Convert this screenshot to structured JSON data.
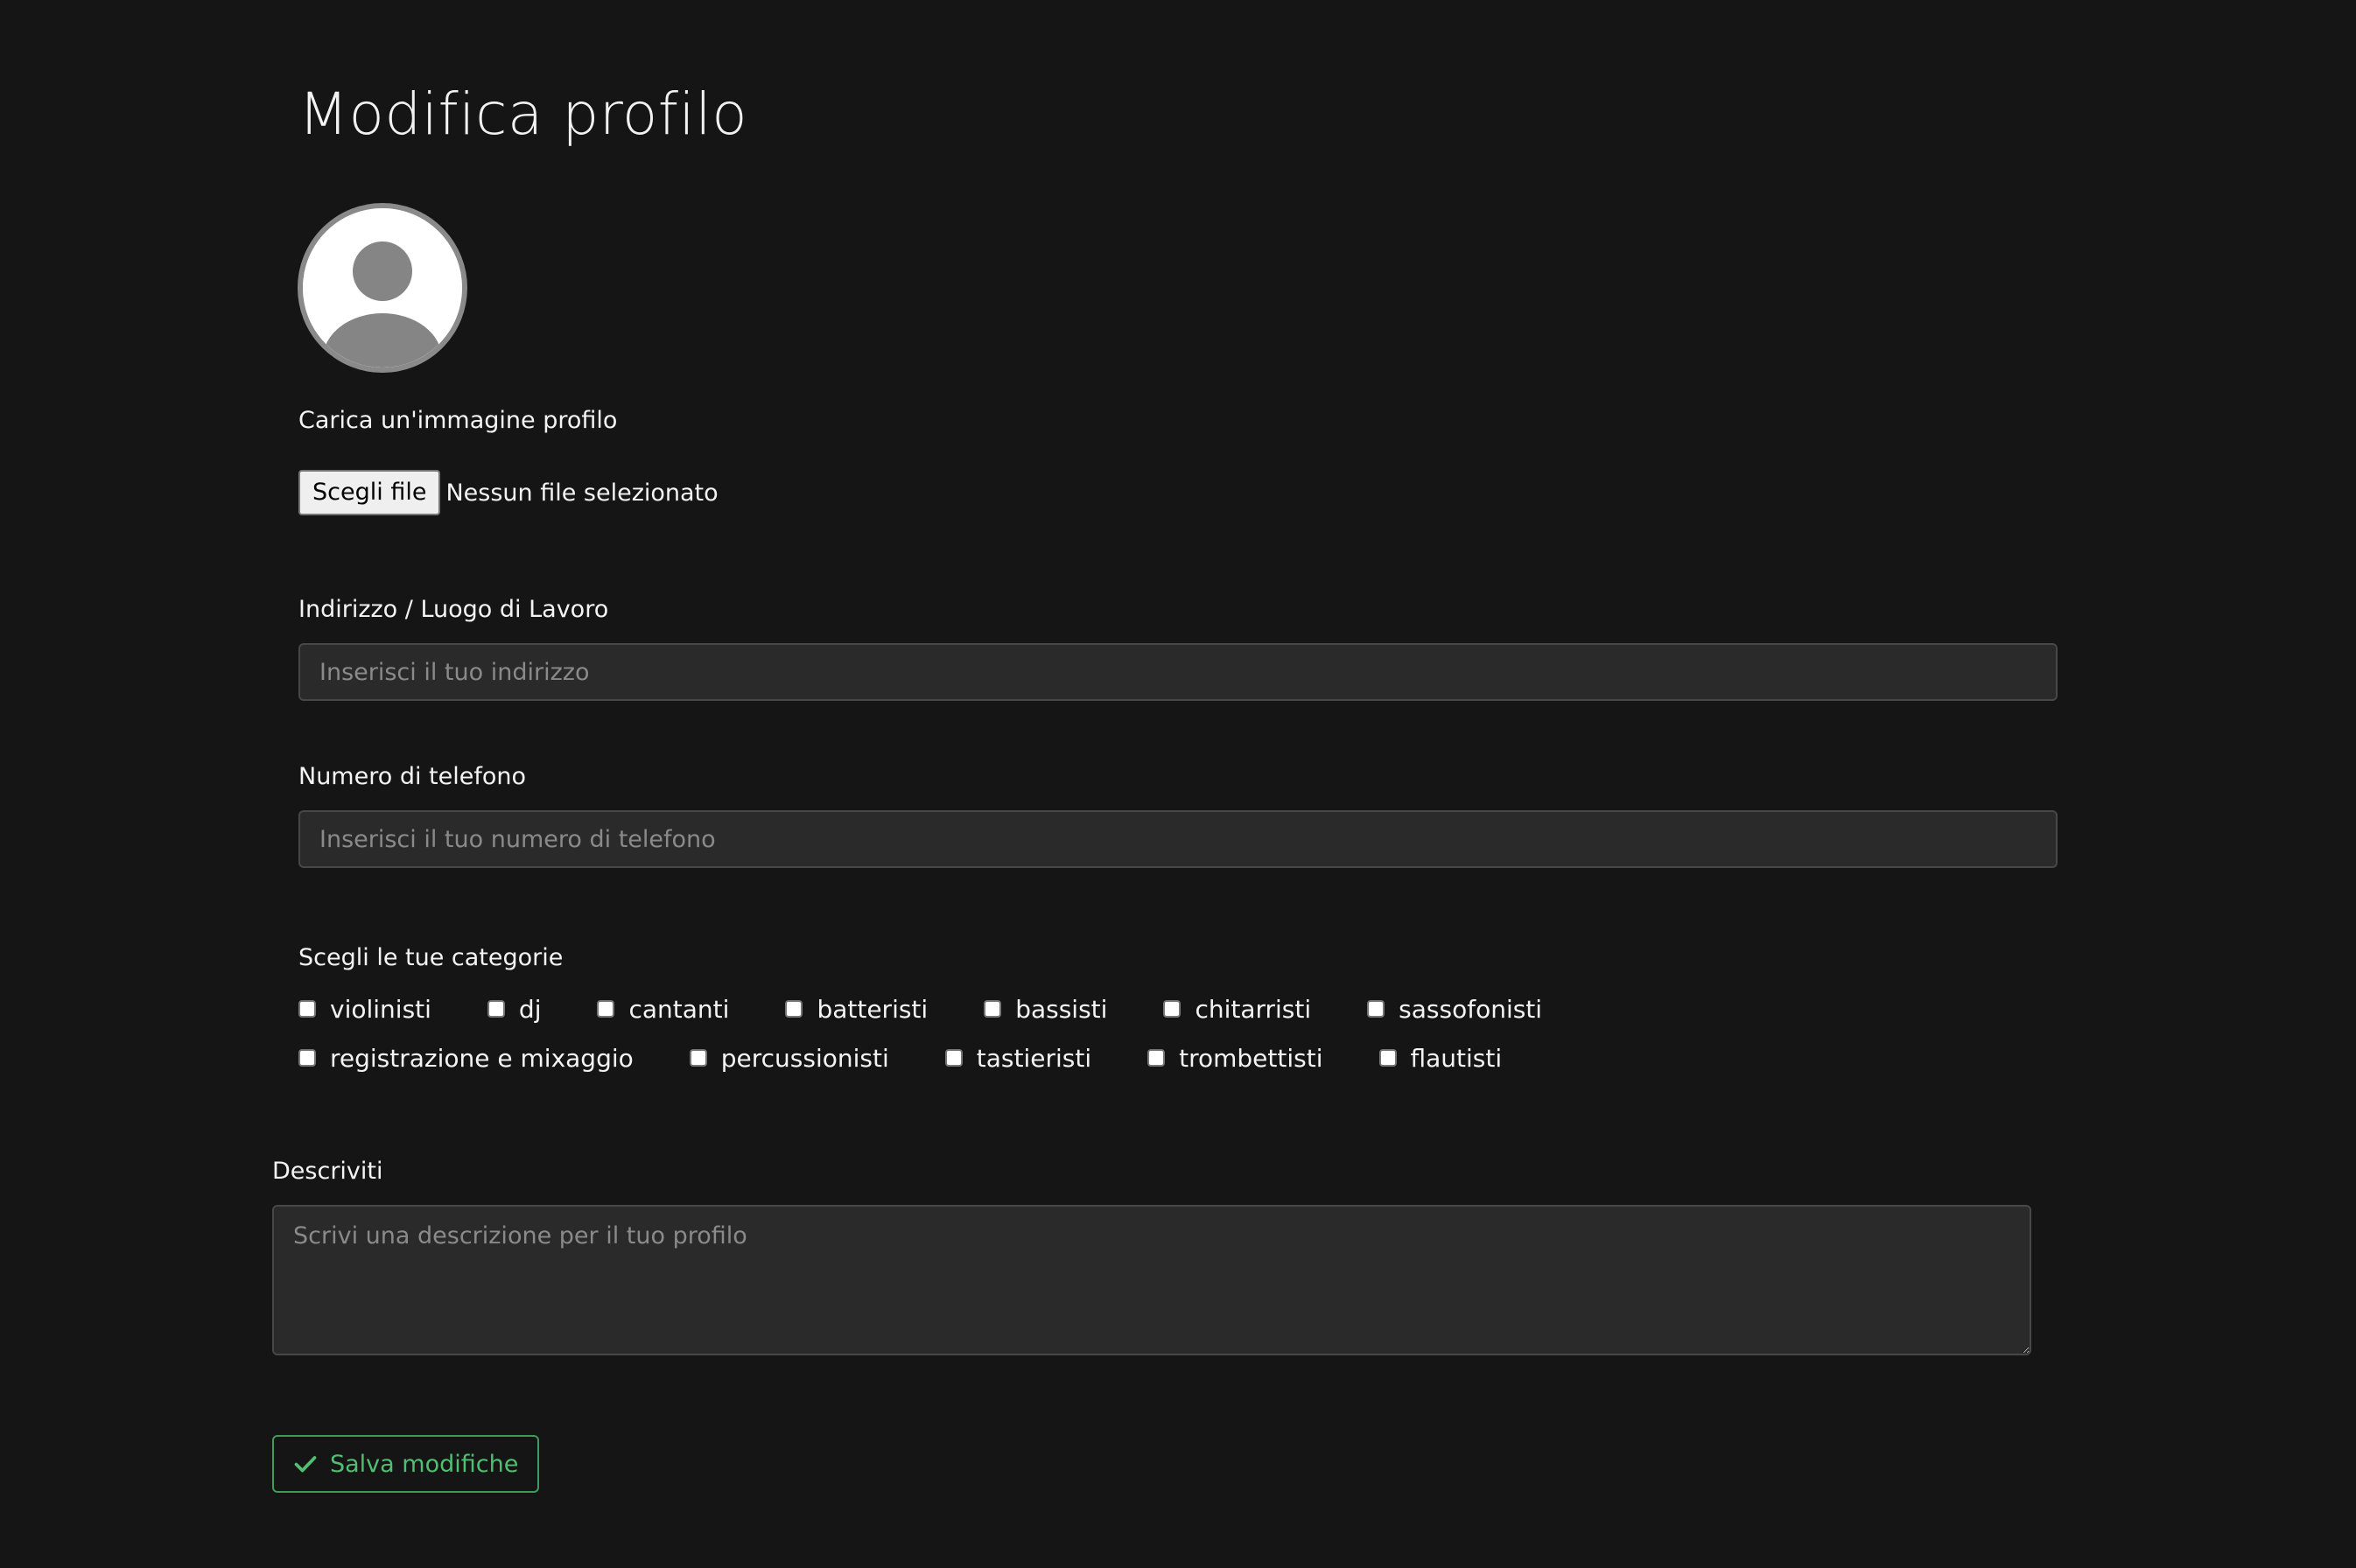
{
  "page": {
    "title": "Modifica profilo"
  },
  "avatar": {
    "icon": "user-silhouette-icon"
  },
  "upload": {
    "label": "Carica un'immagine profilo",
    "button_label": "Scegli file",
    "status": "Nessun file selezionato"
  },
  "address": {
    "label": "Indirizzo / Luogo di Lavoro",
    "placeholder": "Inserisci il tuo indirizzo",
    "value": ""
  },
  "phone": {
    "label": "Numero di telefono",
    "placeholder": "Inserisci il tuo numero di telefono",
    "value": ""
  },
  "categories": {
    "label": "Scegli le tue categorie",
    "row1": [
      {
        "label": "violinisti",
        "checked": false
      },
      {
        "label": "dj",
        "checked": false
      },
      {
        "label": "cantanti",
        "checked": false
      },
      {
        "label": "batteristi",
        "checked": false
      },
      {
        "label": "bassisti",
        "checked": false
      },
      {
        "label": "chitarristi",
        "checked": false
      },
      {
        "label": "sassofonisti",
        "checked": false
      }
    ],
    "row2": [
      {
        "label": "registrazione e mixaggio",
        "checked": false
      },
      {
        "label": "percussionisti",
        "checked": false
      },
      {
        "label": "tastieristi",
        "checked": false
      },
      {
        "label": "trombettisti",
        "checked": false
      },
      {
        "label": "flautisti",
        "checked": false
      }
    ]
  },
  "description": {
    "label": "Descriviti",
    "placeholder": "Scrivi una descrizione per il tuo profilo",
    "value": ""
  },
  "save": {
    "label": "Salva modifiche",
    "icon": "check-icon",
    "color": "#4fbf72"
  },
  "theme": {
    "background": "#151515",
    "input_background": "#2a2a2a",
    "accent_green": "#4fbf72"
  }
}
